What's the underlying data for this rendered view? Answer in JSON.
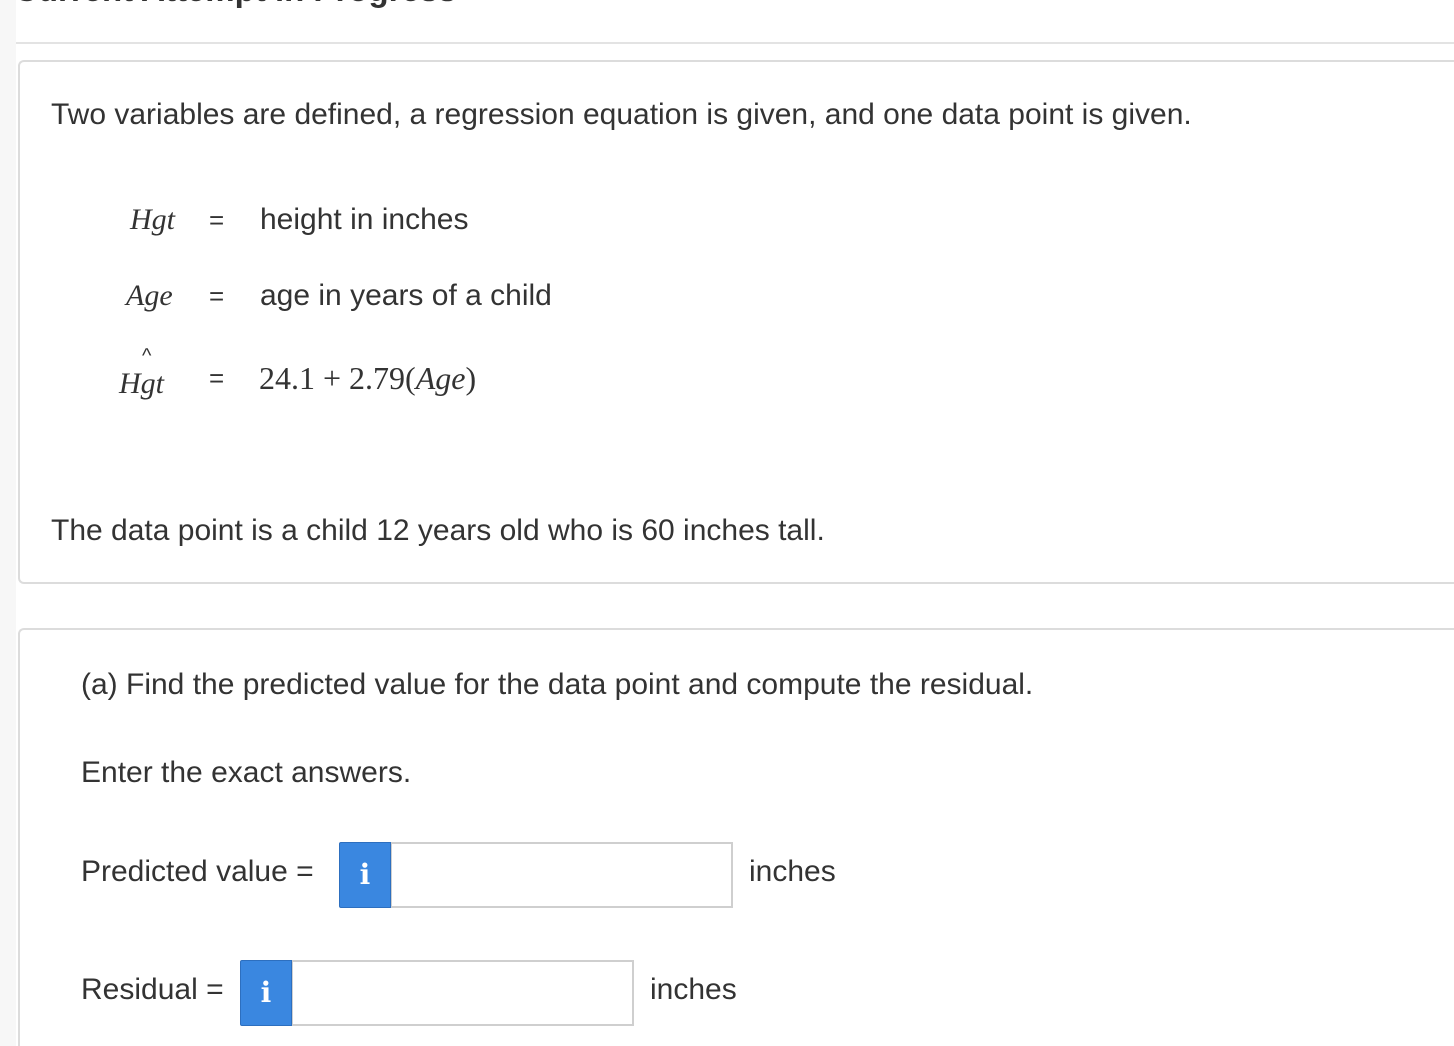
{
  "header": {
    "section_title": "Current Attempt in Progress"
  },
  "problem": {
    "intro": "Two variables are defined, a regression equation is given, and one data point is given.",
    "definitions": [
      {
        "variable": "Hgt",
        "equals": "=",
        "meaning": "height in inches"
      },
      {
        "variable": "Age",
        "equals": "=",
        "meaning": "age in years of a child"
      }
    ],
    "regression": {
      "variable": "Hgt",
      "hat": "^",
      "equals": "=",
      "intercept_text": "24.1 + 2.79(",
      "predictor": "Age",
      "close_paren": ")"
    },
    "data_point": "The data point is a child 12 years old who is 60 inches tall."
  },
  "part_a": {
    "question": "(a) Find the predicted value for the data point and compute the residual.",
    "instruction": "Enter the exact answers.",
    "predicted": {
      "label": "Predicted value =",
      "info_icon": "info-icon",
      "info_glyph": "i",
      "value": "",
      "unit": "inches"
    },
    "residual": {
      "label": "Residual =",
      "info_icon": "info-icon",
      "info_glyph": "i",
      "value": "",
      "unit": "inches"
    }
  },
  "colors": {
    "info_button": "#3a87e0",
    "card_border": "#dcdcdc",
    "text": "#333333"
  }
}
